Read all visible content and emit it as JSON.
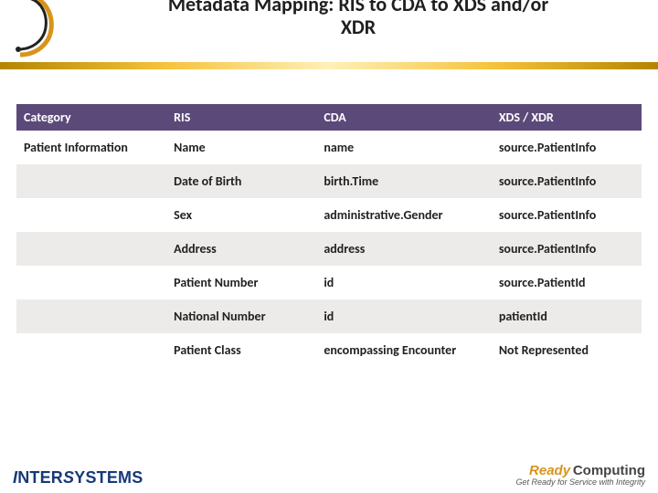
{
  "header": {
    "title_line1": "Metadata Mapping:  RIS to CDA to XDS and/or",
    "title_line2": "XDR"
  },
  "table": {
    "headers": [
      "Category",
      "RIS",
      "CDA",
      "XDS / XDR"
    ],
    "rows": [
      {
        "category": "Patient Information",
        "ris": "Name",
        "cda": "name",
        "xds": "source.PatientInfo"
      },
      {
        "category": "",
        "ris": "Date of Birth",
        "cda": "birth.Time",
        "xds": "source.PatientInfo"
      },
      {
        "category": "",
        "ris": "Sex",
        "cda": "administrative.Gender",
        "xds": "source.PatientInfo"
      },
      {
        "category": "",
        "ris": "Address",
        "cda": "address",
        "xds": "source.PatientInfo"
      },
      {
        "category": "",
        "ris": "Patient Number",
        "cda": "id",
        "xds": "source.PatientId"
      },
      {
        "category": "",
        "ris": "National Number",
        "cda": "id",
        "xds": "patientId"
      },
      {
        "category": "",
        "ris": "Patient Class",
        "cda": "encompassing Encounter",
        "xds": "Not Represented"
      }
    ]
  },
  "footer": {
    "left_brand": "INTERSYSTEMS",
    "right_brand_1a": "Ready",
    "right_brand_1b": "Computing",
    "right_brand_2": "Get Ready for Service with Integrity"
  }
}
